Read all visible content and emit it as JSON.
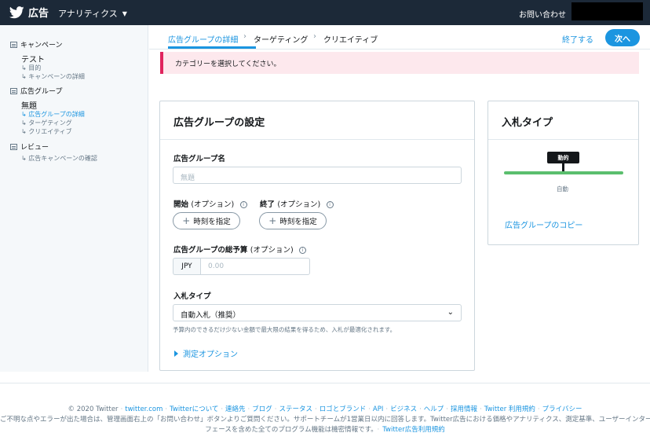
{
  "topbar": {
    "brand": "広告",
    "menu": "アナリティクス",
    "contact": "お問い合わせ"
  },
  "sidebar": {
    "campaign_header": "キャンペーン",
    "campaign_title": "テスト",
    "campaign_items": [
      "↳ 目的",
      "↳ キャンペーンの詳細"
    ],
    "adgroup_header": "広告グループ",
    "adgroup_title": "無題",
    "adgroup_items": [
      "↳ 広告グループの詳細",
      "↳ ターゲティング",
      "↳ クリエイティブ"
    ],
    "review_header": "レビュー",
    "review_items": [
      "↳ 広告キャンペーンの確認"
    ]
  },
  "steps": {
    "items": [
      "広告グループの詳細",
      "ターゲティング",
      "クリエイティブ"
    ],
    "separator": "›",
    "finish": "終了する",
    "next": "次へ"
  },
  "alert": {
    "text": "カテゴリーを選択してください。",
    "color": "#e0245e"
  },
  "settings": {
    "title": "広告グループの設定",
    "name_label": "広告グループ名",
    "name_placeholder": "無題",
    "start_label": "開始",
    "end_label": "終了",
    "optional": "(オプション)",
    "set_time": "時刻を指定",
    "budget_label": "広告グループの総予算",
    "currency": "JPY",
    "budget_placeholder": "0.00",
    "bid_type_label": "入札タイプ",
    "bid_type_value": "自動入札（推奨）",
    "bid_help": "予算内のできるだけ少ない金額で最大限の結果を得るため、入札が最適化されます。",
    "measure_options": "測定オプション"
  },
  "bid_card": {
    "title": "入札タイプ",
    "tooltip": "動的",
    "auto_label": "自動",
    "copy_link": "広告グループのコピー",
    "bar_color": "#5bbf6e"
  },
  "footer": {
    "copyright": "© 2020 Twitter",
    "links": [
      "twitter.com",
      "Twitterについて",
      "連絡先",
      "ブログ",
      "ステータス",
      "ロゴとブランド",
      "API",
      "ビジネス",
      "ヘルプ",
      "採用情報",
      "Twitter 利用規約",
      "プライバシー"
    ],
    "note_line1": "ご不明な点やエラーが出た場合は、管理画面右上の「お問い合わせ」ボタンよりご質問ください。サポートチームが1営業日以内に回答します。Twitter広告における価格やアナリティクス、測定基準、ユーザーインター",
    "note_line2": "フェースを含めた全てのプログラム機能は機密情報です。",
    "terms_link": "Twitter広告利用規約"
  },
  "accent_color": "#1b95e0"
}
